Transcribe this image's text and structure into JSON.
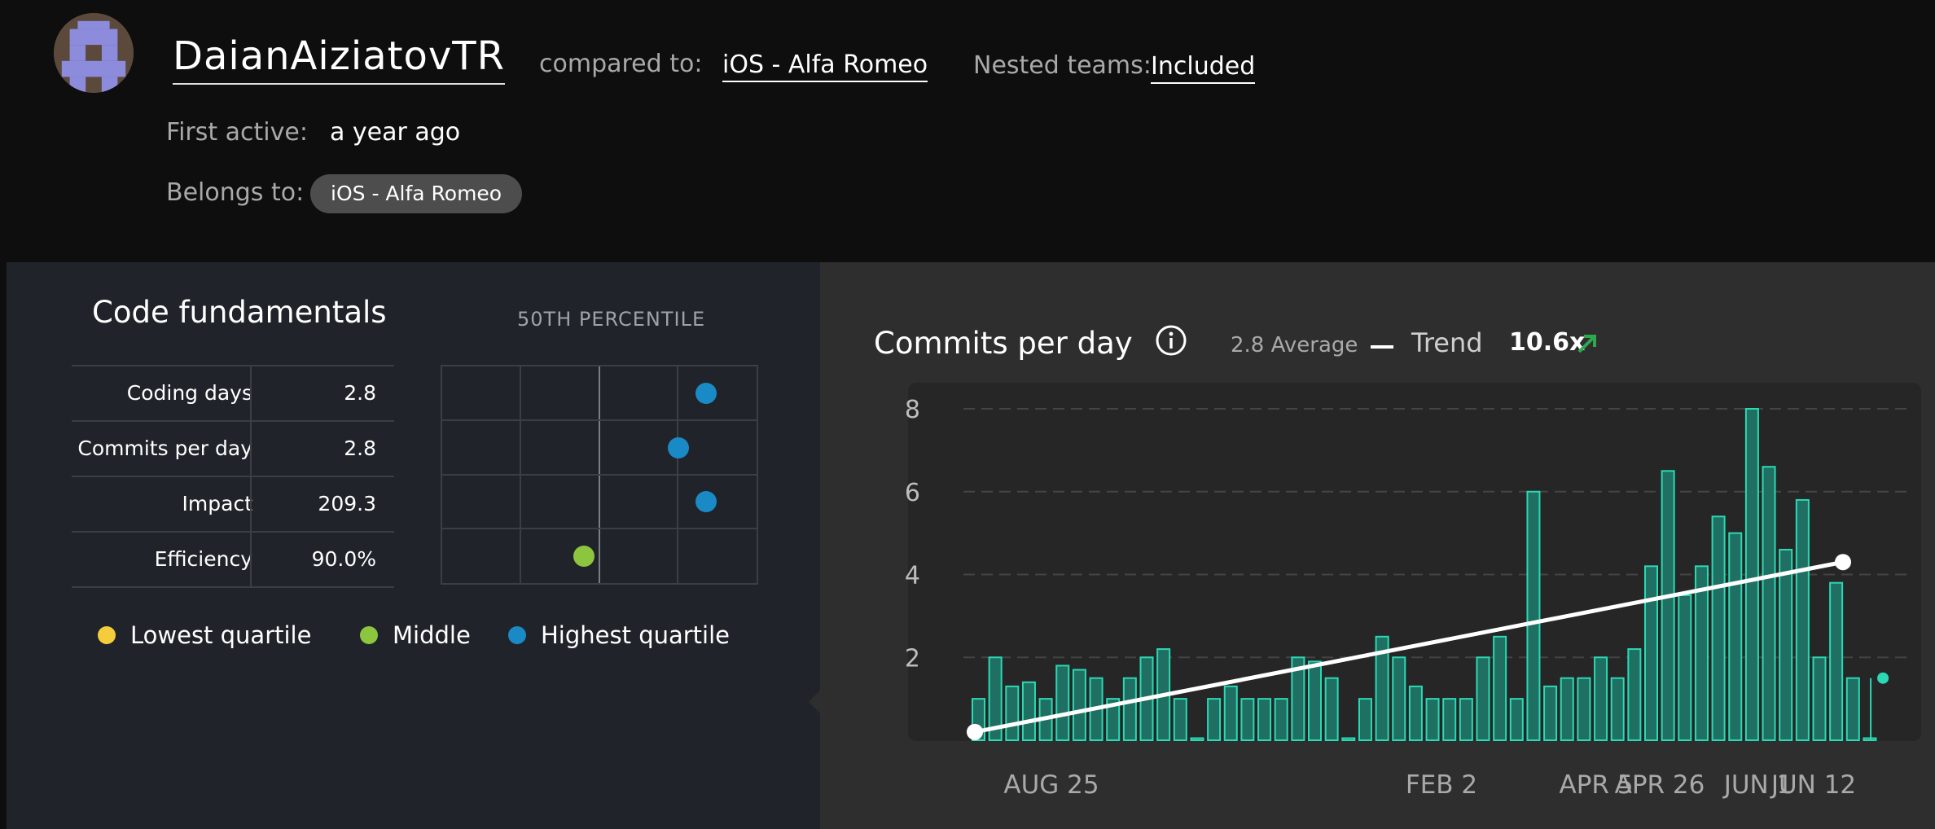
{
  "header": {
    "username": "DaianAiziatovTR",
    "compared_label": "compared to:",
    "compared_value": "iOS - Alfa Romeo",
    "nested_label": "Nested teams:",
    "nested_value": "Included",
    "first_active_label": "First active:",
    "first_active_value": "a year ago",
    "belongs_label": "Belongs to:",
    "belongs_value": "iOS - Alfa Romeo"
  },
  "fundamentals": {
    "title": "Code fundamentals",
    "percentile_title": "50TH PERCENTILE",
    "metrics": [
      {
        "name": "Coding days",
        "value": "2.8",
        "percentile_position": 0.84,
        "quartile": "highest"
      },
      {
        "name": "Commits per day",
        "value": "2.8",
        "percentile_position": 0.75,
        "quartile": "highest"
      },
      {
        "name": "Impact",
        "value": "209.3",
        "percentile_position": 0.84,
        "quartile": "highest"
      },
      {
        "name": "Efficiency",
        "value": "90.0%",
        "percentile_position": 0.45,
        "quartile": "middle"
      }
    ],
    "legend": [
      {
        "label": "Lowest quartile",
        "color": "#f5cd3c"
      },
      {
        "label": "Middle",
        "color": "#8cc63f"
      },
      {
        "label": "Highest quartile",
        "color": "#1a8ac6"
      }
    ]
  },
  "commits": {
    "title": "Commits per day",
    "average_label": "2.8 Average",
    "trend_label": "Trend",
    "trend_value": "10.6x",
    "colors": {
      "bar": "#1f6f62",
      "bar_stroke": "#2bd9b4",
      "trend": "#ffffff",
      "up_arrow": "#2ea84f"
    }
  },
  "chart_data": {
    "type": "bar",
    "ylim": [
      0,
      8
    ],
    "yticks": [
      2,
      4,
      6,
      8
    ],
    "xtick_labels": [
      "AUG 25",
      "FEB 2",
      "APR 5",
      "APR 26",
      "JUN 1",
      "JUN 12"
    ],
    "grid": "horizontal dashed",
    "values": [
      1.0,
      2.0,
      1.3,
      1.4,
      1.0,
      1.8,
      1.7,
      1.5,
      1.0,
      1.5,
      2.0,
      2.2,
      1.0,
      0.05,
      1.0,
      1.3,
      1.0,
      1.0,
      1.0,
      2.0,
      1.9,
      1.5,
      0.05,
      1.0,
      2.5,
      2.0,
      1.3,
      1.0,
      1.0,
      1.0,
      2.0,
      2.5,
      1.0,
      6.0,
      1.3,
      1.5,
      1.5,
      2.0,
      1.5,
      2.2,
      4.2,
      6.5,
      3.5,
      4.2,
      5.4,
      5.0,
      8.0,
      6.6,
      4.6,
      5.8,
      2.0,
      3.8,
      1.5,
      0.05
    ],
    "last_point": 1.5,
    "trend": {
      "start": 0.2,
      "end": 4.3
    }
  }
}
